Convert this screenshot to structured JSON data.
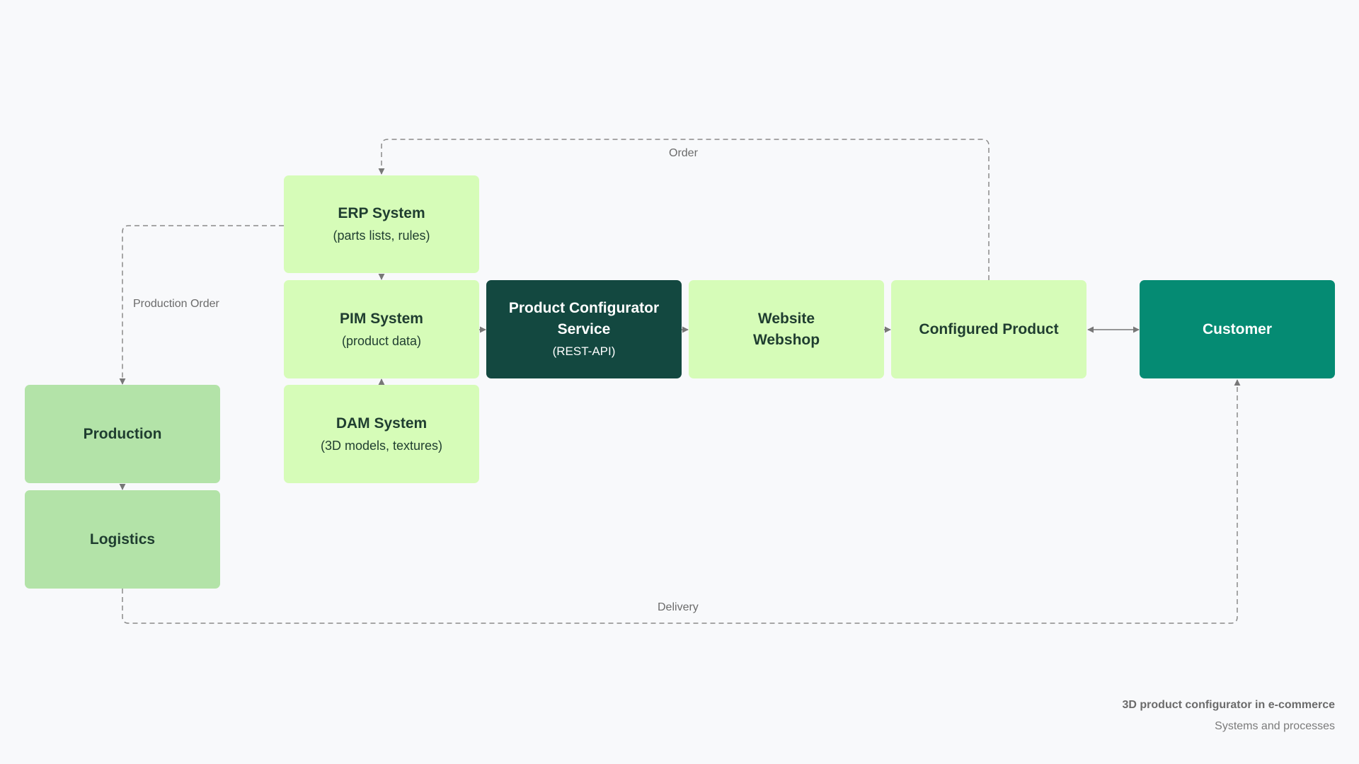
{
  "colors": {
    "light_green": "#d6fcb8",
    "mid_green": "#b3e3a8",
    "dark_green": "#134840",
    "teal": "#058b73",
    "connector": "#777777"
  },
  "nodes": {
    "erp": {
      "title": "ERP System",
      "subtitle": "(parts lists, rules)"
    },
    "pim": {
      "title": "PIM System",
      "subtitle": "(product data)"
    },
    "dam": {
      "title": "DAM System",
      "subtitle": "(3D models, textures)"
    },
    "configurator": {
      "title_line1": "Product Configurator",
      "title_line2": "Service",
      "subtitle": "(REST-API)"
    },
    "website": {
      "title_line1": "Website",
      "title_line2": "Webshop"
    },
    "configured_product": {
      "title": "Configured Product"
    },
    "customer": {
      "title": "Customer"
    },
    "production": {
      "title": "Production"
    },
    "logistics": {
      "title": "Logistics"
    }
  },
  "flows": {
    "order": "Order",
    "production_order": "Production Order",
    "delivery": "Delivery"
  },
  "footer": {
    "title": "3D product configurator in e-commerce",
    "subtitle": "Systems and processes"
  }
}
